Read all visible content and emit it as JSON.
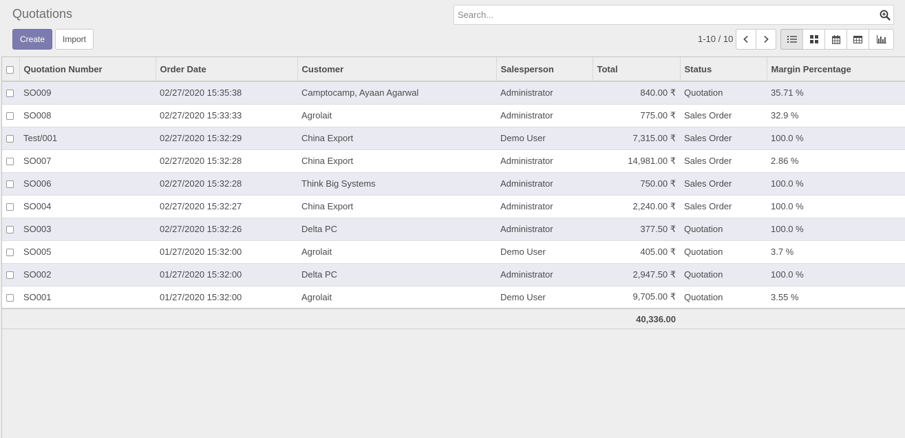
{
  "control_panel": {
    "title": "Quotations",
    "create_label": "Create",
    "import_label": "Import",
    "search_placeholder": "Search...",
    "pager": "1-10 / 10",
    "views": [
      "list-view-icon",
      "kanban-view-icon",
      "calendar-view-icon",
      "pivot-view-icon",
      "graph-view-icon"
    ],
    "active_view": "list"
  },
  "table": {
    "headers": {
      "number": "Quotation Number",
      "date": "Order Date",
      "customer": "Customer",
      "salesperson": "Salesperson",
      "total": "Total",
      "status": "Status",
      "margin": "Margin Percentage"
    },
    "rows": [
      {
        "number": "SO009",
        "date": "02/27/2020 15:35:38",
        "customer": "Camptocamp, Ayaan Agarwal",
        "salesperson": "Administrator",
        "total": "840.00 ₹",
        "status": "Quotation",
        "margin": "35.71 %"
      },
      {
        "number": "SO008",
        "date": "02/27/2020 15:33:33",
        "customer": "Agrolait",
        "salesperson": "Administrator",
        "total": "775.00 ₹",
        "status": "Sales Order",
        "margin": "32.9 %"
      },
      {
        "number": "Test/001",
        "date": "02/27/2020 15:32:29",
        "customer": "China Export",
        "salesperson": "Demo User",
        "total": "7,315.00 ₹",
        "status": "Sales Order",
        "margin": "100.0 %"
      },
      {
        "number": "SO007",
        "date": "02/27/2020 15:32:28",
        "customer": "China Export",
        "salesperson": "Administrator",
        "total": "14,981.00 ₹",
        "status": "Sales Order",
        "margin": "2.86 %"
      },
      {
        "number": "SO006",
        "date": "02/27/2020 15:32:28",
        "customer": "Think Big Systems",
        "salesperson": "Administrator",
        "total": "750.00 ₹",
        "status": "Sales Order",
        "margin": "100.0 %"
      },
      {
        "number": "SO004",
        "date": "02/27/2020 15:32:27",
        "customer": "China Export",
        "salesperson": "Administrator",
        "total": "2,240.00 ₹",
        "status": "Sales Order",
        "margin": "100.0 %"
      },
      {
        "number": "SO003",
        "date": "02/27/2020 15:32:26",
        "customer": "Delta PC",
        "salesperson": "Administrator",
        "total": "377.50 ₹",
        "status": "Quotation",
        "margin": "100.0 %"
      },
      {
        "number": "SO005",
        "date": "01/27/2020 15:32:00",
        "customer": "Agrolait",
        "salesperson": "Demo User",
        "total": "405.00 ₹",
        "status": "Quotation",
        "margin": "3.7 %"
      },
      {
        "number": "SO002",
        "date": "01/27/2020 15:32:00",
        "customer": "Delta PC",
        "salesperson": "Administrator",
        "total": "2,947.50 ₹",
        "status": "Quotation",
        "margin": "100.0 %"
      },
      {
        "number": "SO001",
        "date": "01/27/2020 15:32:00",
        "customer": "Agrolait",
        "salesperson": "Demo User",
        "total": "9,705.00 ₹",
        "status": "Quotation",
        "margin": "3.55 %"
      }
    ],
    "footer_total": "40,336.00"
  },
  "colors": {
    "accent": "#7c7bad",
    "background": "#efeeef",
    "row_stripe": "#eaeaf3"
  }
}
